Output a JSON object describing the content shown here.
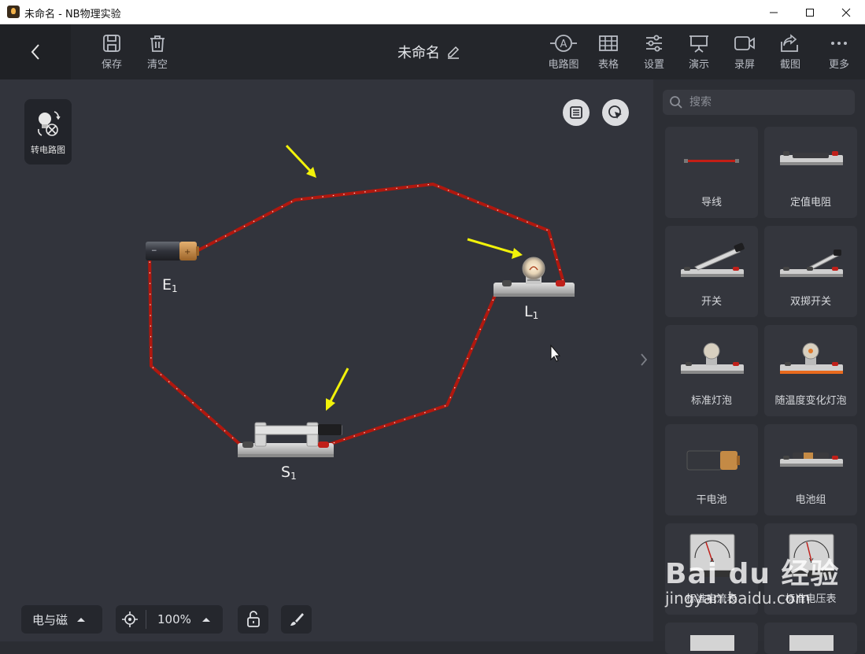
{
  "window": {
    "title": "未命名 - NB物理实验"
  },
  "toolbar": {
    "save_label": "保存",
    "clear_label": "清空",
    "doc_title": "未命名",
    "circuit_label": "电路图",
    "table_label": "表格",
    "settings_label": "设置",
    "present_label": "演示",
    "record_label": "录屏",
    "screenshot_label": "截图",
    "more_label": "更多"
  },
  "canvas": {
    "convert_label": "转电路图",
    "components": {
      "battery_label": "E",
      "battery_sub": "1",
      "bulb_label": "L",
      "bulb_sub": "1",
      "switch_label": "S",
      "switch_sub": "1"
    }
  },
  "bottom": {
    "category": "电与磁",
    "zoom": "100%"
  },
  "sidebar": {
    "search_placeholder": "搜索",
    "items": [
      {
        "label": "导线"
      },
      {
        "label": "定值电阻"
      },
      {
        "label": "开关"
      },
      {
        "label": "双掷开关"
      },
      {
        "label": "标准灯泡"
      },
      {
        "label": "随温度变化灯泡"
      },
      {
        "label": "干电池"
      },
      {
        "label": "电池组"
      },
      {
        "label": "标准电流表"
      },
      {
        "label": "标准电压表"
      }
    ]
  },
  "watermark": {
    "brand": "Bai du 经验",
    "url": "jingyan.baidu.com"
  },
  "colors": {
    "wire": "#b0180f",
    "arrow": "#f2f20a",
    "canvas": "#32343c"
  }
}
